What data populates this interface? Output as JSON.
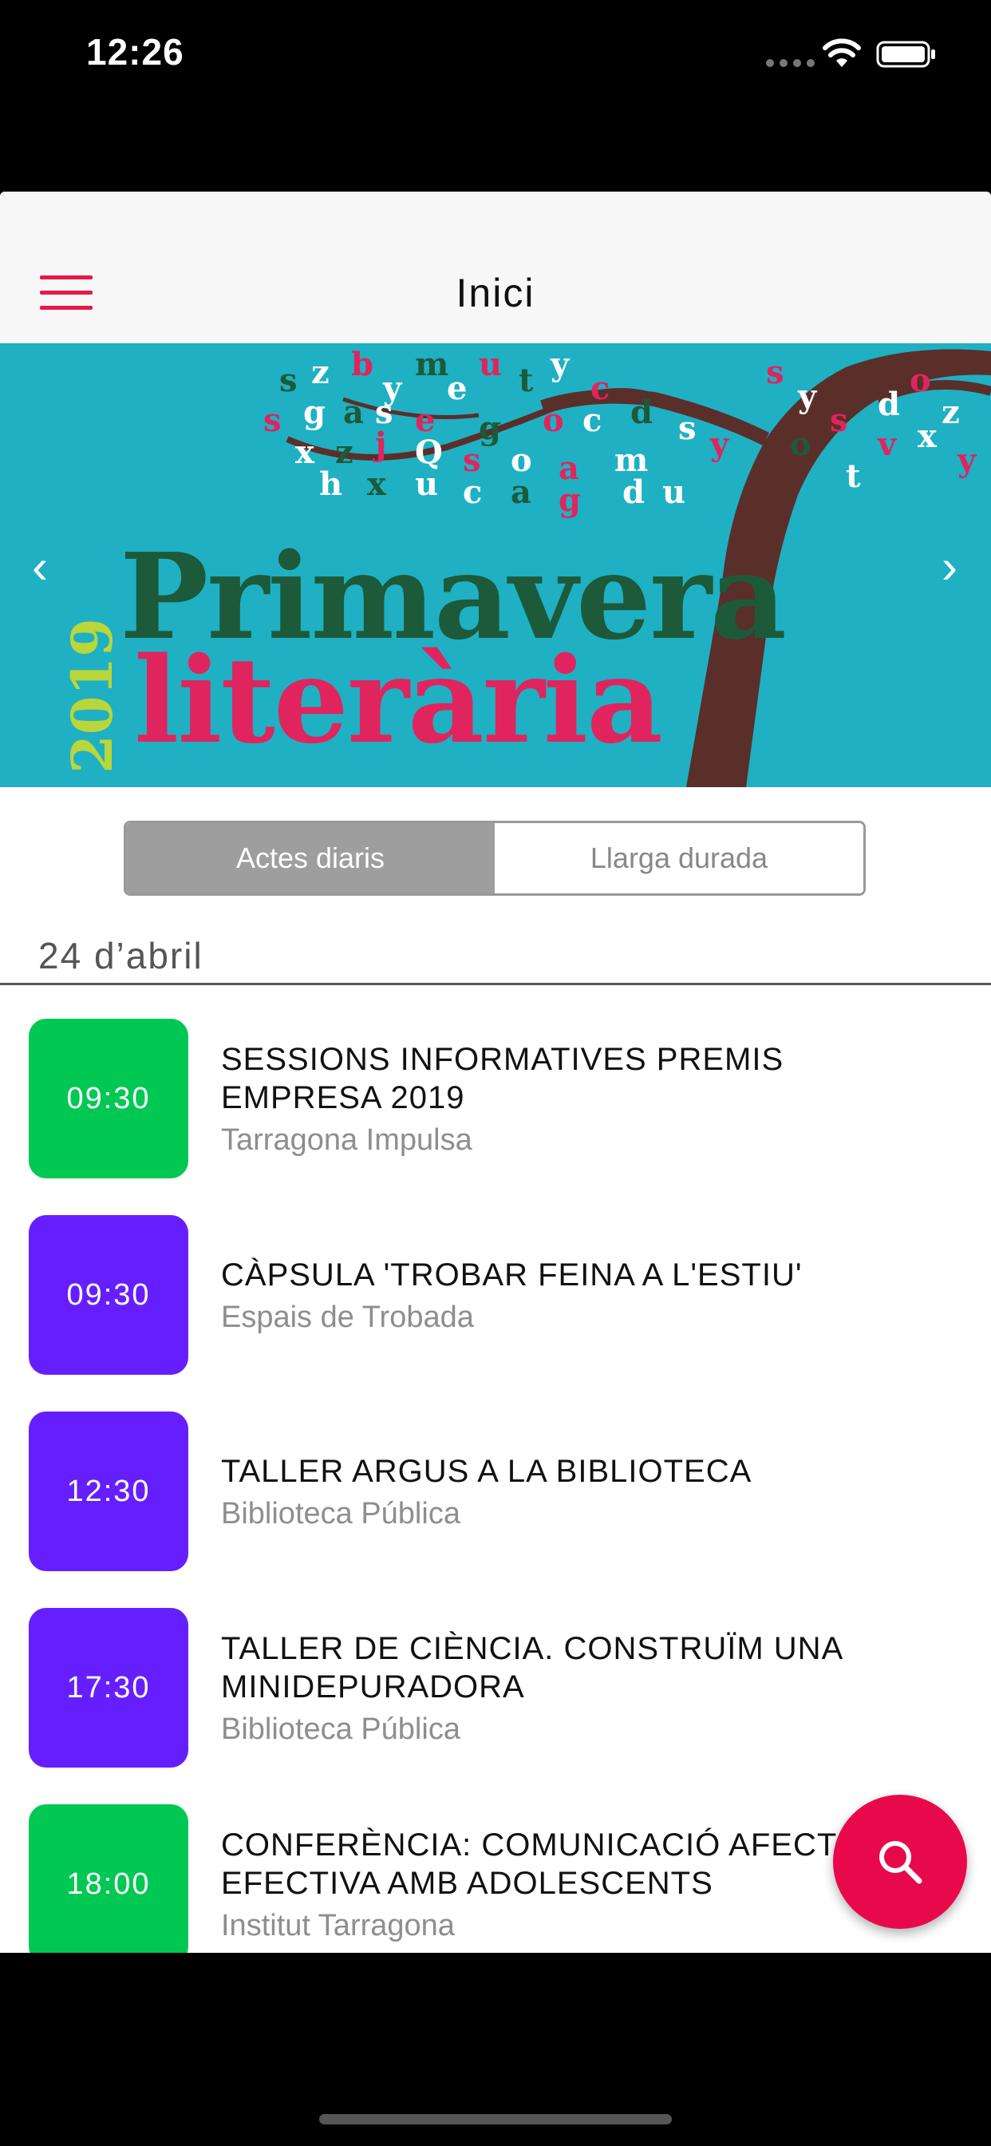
{
  "status_bar": {
    "time": "12:26"
  },
  "nav": {
    "title": "Inici",
    "menu_icon": "hamburger-menu-icon"
  },
  "banner": {
    "title_line1": "Primavera",
    "title_line2": "literària",
    "year": "2019",
    "prev_icon": "chevron-left-icon",
    "next_icon": "chevron-right-icon"
  },
  "tabs": [
    {
      "label": "Actes diaris",
      "selected": true
    },
    {
      "label": "Llarga durada",
      "selected": false
    }
  ],
  "date_header": "24 d’abril",
  "events": [
    {
      "time": "09:30",
      "color": "#00c853",
      "title": "SESSIONS INFORMATIVES PREMIS EMPRESA 2019",
      "location": "Tarragona Impulsa"
    },
    {
      "time": "09:30",
      "color": "#651fff",
      "title": "CÀPSULA 'TROBAR FEINA A L'ESTIU'",
      "location": "Espais de Trobada"
    },
    {
      "time": "12:30",
      "color": "#651fff",
      "title": "TALLER ARGUS A LA BIBLIOTECA",
      "location": "Biblioteca Pública"
    },
    {
      "time": "17:30",
      "color": "#651fff",
      "title": "TALLER DE CIÈNCIA. CONSTRUÏM UNA MINIDEPURADORA",
      "location": "Biblioteca Pública"
    },
    {
      "time": "18:00",
      "color": "#00c853",
      "title": "CONFERÈNCIA: COMUNICACIÓ AFECTIVA I EFECTIVA AMB ADOLESCENTS",
      "location": "Institut Tarragona"
    }
  ],
  "fab": {
    "icon": "search-icon",
    "color": "#e8094b"
  }
}
